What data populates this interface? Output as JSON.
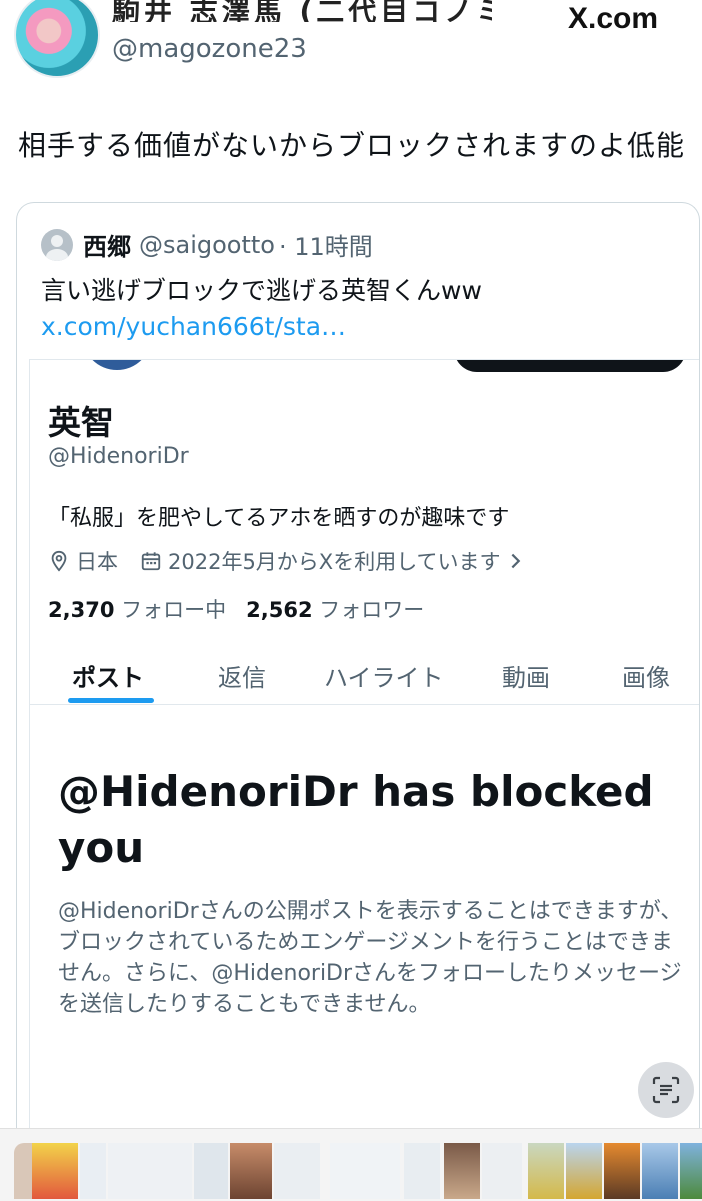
{
  "header": {
    "display_name": "駒井 志澤馬 (二代目コノミイ",
    "handle": "@magozone23",
    "site": "X.com"
  },
  "tweet": {
    "text": "相手する価値がないからブロックされますのよ低能"
  },
  "quote": {
    "author_name": "西郷",
    "author_handle": "@saigootto",
    "time": "· 11時間",
    "text": "言い逃げブロックで逃げる英智くんww ",
    "link": "x.com/yuchan666t/sta…"
  },
  "profile": {
    "name": "英智",
    "handle": "@HidenoriDr",
    "bio": "「私服」を肥やしてるアホを晒すのが趣味です",
    "location": "日本",
    "joined": "2022年5月からXを利用しています",
    "following_count": "2,370",
    "following_label": "フォロー中",
    "followers_count": "2,562",
    "followers_label": "フォロワー",
    "tabs": [
      "ポスト",
      "返信",
      "ハイライト",
      "動画",
      "画像"
    ],
    "active_tab": "ポスト"
  },
  "blocked": {
    "title": "@HidenoriDr has blocked you",
    "body": "@HidenoriDrさんの公開ポストを表示することはできますが、ブロックされているためエンゲージメントを行うことはできません。さらに、@HidenoriDrさんをフォローしたりメッセージを送信したりすることもできません。"
  },
  "icons": [
    "avatar",
    "location-icon",
    "calendar-icon",
    "chevron-right-icon",
    "lens-scan-icon"
  ],
  "colors": {
    "accent": "#1d9bf0",
    "text_primary": "#0f1419",
    "text_secondary": "#536471",
    "border": "#cfd9de"
  }
}
